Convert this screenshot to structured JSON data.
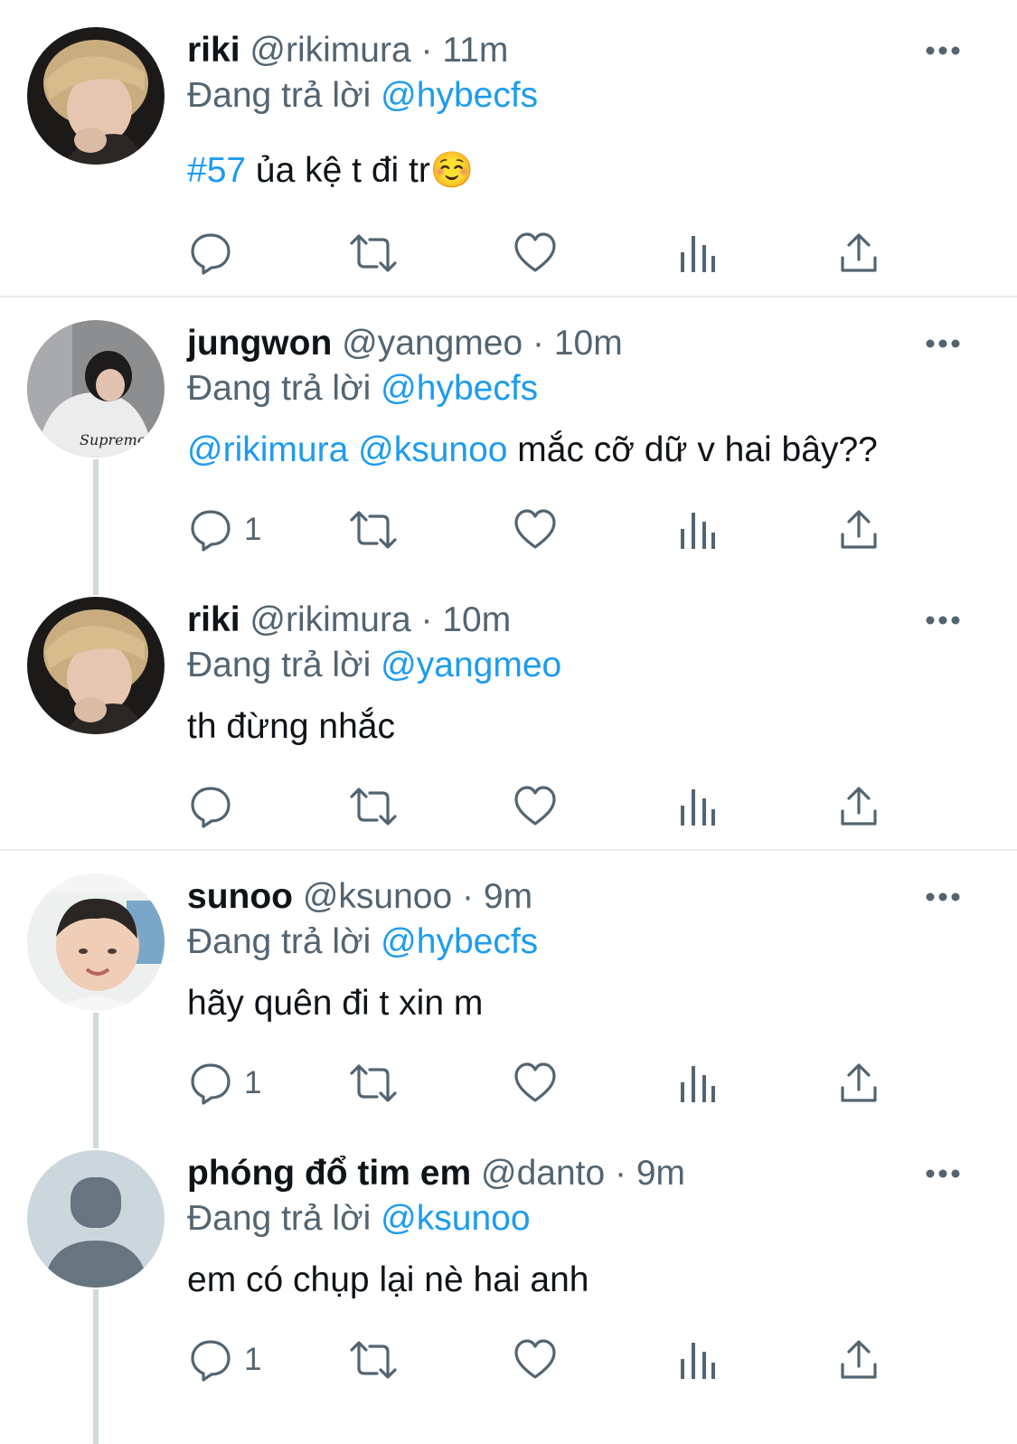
{
  "tweets": [
    {
      "name": "riki",
      "handle": "@rikimura",
      "dot": "·",
      "time": "11m",
      "reply_prefix": "Đang trả lời",
      "reply_to": "@hybecfs",
      "text_link": "#57",
      "text_link2": "",
      "text": " ủa kệ t đi tr☺️",
      "reply_count": "",
      "avatar": "photo-blonde-hair-hoodie"
    },
    {
      "name": "jungwon",
      "handle": "@yangmeo",
      "dot": "·",
      "time": "10m",
      "reply_prefix": "Đang trả lời",
      "reply_to": "@hybecfs",
      "text_link": "@rikimura",
      "text_link2": " @ksunoo",
      "text": " mắc cỡ dữ v hai bây??",
      "reply_count": "1",
      "avatar": "photo-white-hoodie"
    },
    {
      "name": "riki",
      "handle": "@rikimura",
      "dot": "·",
      "time": "10m",
      "reply_prefix": "Đang trả lời",
      "reply_to": "@yangmeo",
      "text_link": "",
      "text_link2": "",
      "text": "th đừng nhắc",
      "reply_count": "",
      "avatar": "photo-blonde-hair-hoodie"
    },
    {
      "name": "sunoo",
      "handle": "@ksunoo",
      "dot": "·",
      "time": "9m",
      "reply_prefix": "Đang trả lời",
      "reply_to": "@hybecfs",
      "text_link": "",
      "text_link2": "",
      "text": "hãy quên đi t xin m",
      "reply_count": "1",
      "avatar": "photo-child"
    },
    {
      "name": "phóng đổ tim em",
      "handle": "@danto",
      "dot": "·",
      "time": "9m",
      "reply_prefix": "Đang trả lời",
      "reply_to": "@ksunoo",
      "text_link": "",
      "text_link2": "",
      "text": "em có chụp lại nè hai anh",
      "reply_count": "1",
      "avatar": "default-avatar-icon"
    }
  ],
  "colors": {
    "link": "#1d9bf0",
    "secondary_text": "#536471",
    "icon": "#536471",
    "divider": "#e6ecf0",
    "thread_line": "#cfd9de"
  },
  "icons": [
    "reply-icon",
    "retweet-icon",
    "like-icon",
    "views-icon",
    "share-icon",
    "more-icon"
  ]
}
